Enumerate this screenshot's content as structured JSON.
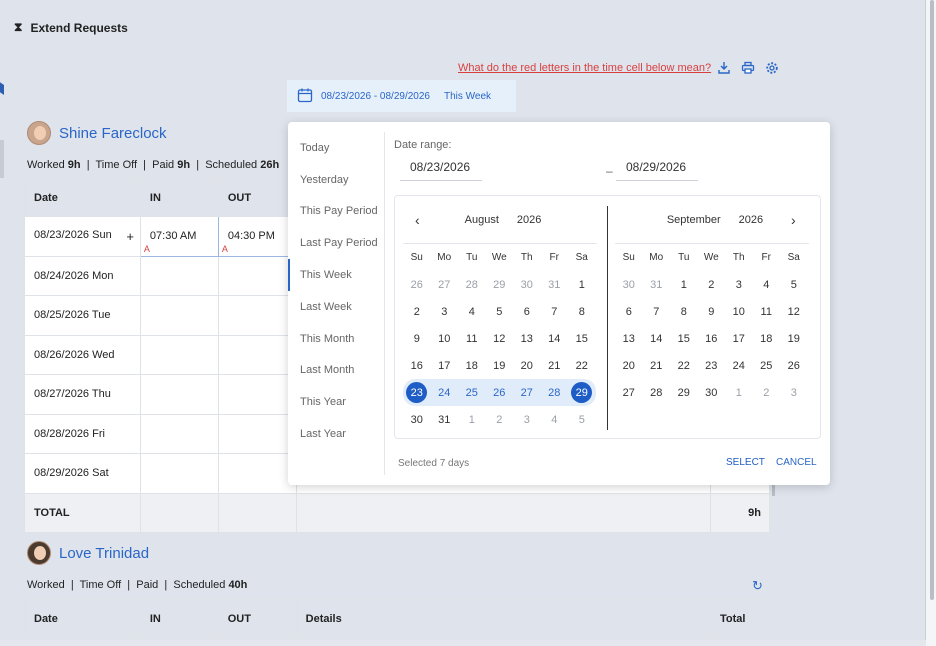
{
  "header": {
    "icon": "hourglass-icon",
    "title": "Extend Requests"
  },
  "help_link": "What do the red letters in the time cell below mean?",
  "date_trigger": {
    "range": "08/23/2026 - 08/29/2026",
    "label": "This Week"
  },
  "employees": [
    {
      "name": "Shine Fareclock",
      "summary": {
        "worked_label": "Worked",
        "worked": "9h",
        "time_off_label": "Time Off",
        "paid_label": "Paid",
        "paid": "9h",
        "scheduled_label": "Scheduled",
        "scheduled": "26h"
      },
      "columns": [
        "Date",
        "IN",
        "OUT"
      ],
      "rows": [
        {
          "date": "08/23/2026 Sun",
          "in": "07:30 AM",
          "out": "04:30 PM",
          "flag": "A"
        },
        {
          "date": "08/24/2026 Mon",
          "in": "",
          "out": ""
        },
        {
          "date": "08/25/2026 Tue",
          "in": "",
          "out": ""
        },
        {
          "date": "08/26/2026 Wed",
          "in": "",
          "out": ""
        },
        {
          "date": "08/27/2026 Thu",
          "in": "",
          "out": ""
        },
        {
          "date": "08/28/2026 Fri",
          "in": "",
          "out": ""
        },
        {
          "date": "08/29/2026 Sat",
          "in": "",
          "out": ""
        }
      ],
      "total_label": "TOTAL",
      "total": "9h"
    },
    {
      "name": "Love Trinidad",
      "summary": {
        "worked_label": "Worked",
        "time_off_label": "Time Off",
        "paid_label": "Paid",
        "scheduled_label": "Scheduled",
        "scheduled": "40h"
      },
      "columns": [
        "Date",
        "IN",
        "OUT",
        "Details",
        "Total"
      ]
    }
  ],
  "popup": {
    "presets": [
      "Today",
      "Yesterday",
      "This Pay Period",
      "Last Pay Period",
      "This Week",
      "Last Week",
      "This Month",
      "Last Month",
      "This Year",
      "Last Year"
    ],
    "active_preset": "This Week",
    "range_label": "Date range:",
    "start": "08/23/2026",
    "end": "08/29/2026",
    "dash": "–",
    "weekdays": [
      "Su",
      "Mo",
      "Tu",
      "We",
      "Th",
      "Fr",
      "Sa"
    ],
    "left_month": {
      "month": "August",
      "year": "2026",
      "days": [
        "26",
        "27",
        "28",
        "29",
        "30",
        "31",
        "1",
        "2",
        "3",
        "4",
        "5",
        "6",
        "7",
        "8",
        "9",
        "10",
        "11",
        "12",
        "13",
        "14",
        "15",
        "16",
        "17",
        "18",
        "19",
        "20",
        "21",
        "22",
        "23",
        "24",
        "25",
        "26",
        "27",
        "28",
        "29",
        "30",
        "31",
        "1",
        "2",
        "3",
        "4",
        "5"
      ]
    },
    "right_month": {
      "month": "September",
      "year": "2026",
      "days": [
        "30",
        "31",
        "1",
        "2",
        "3",
        "4",
        "5",
        "6",
        "7",
        "8",
        "9",
        "10",
        "11",
        "12",
        "13",
        "14",
        "15",
        "16",
        "17",
        "18",
        "19",
        "20",
        "21",
        "22",
        "23",
        "24",
        "25",
        "26",
        "27",
        "28",
        "29",
        "30",
        "1",
        "2",
        "3"
      ]
    },
    "selected_count": "Selected 7 days",
    "select_label": "SELECT",
    "cancel_label": "CANCEL"
  },
  "colors": {
    "accent": "#1e5cc6",
    "link": "#2a66c7",
    "warning": "#d84040",
    "page_bg": "#dfe4ec"
  }
}
